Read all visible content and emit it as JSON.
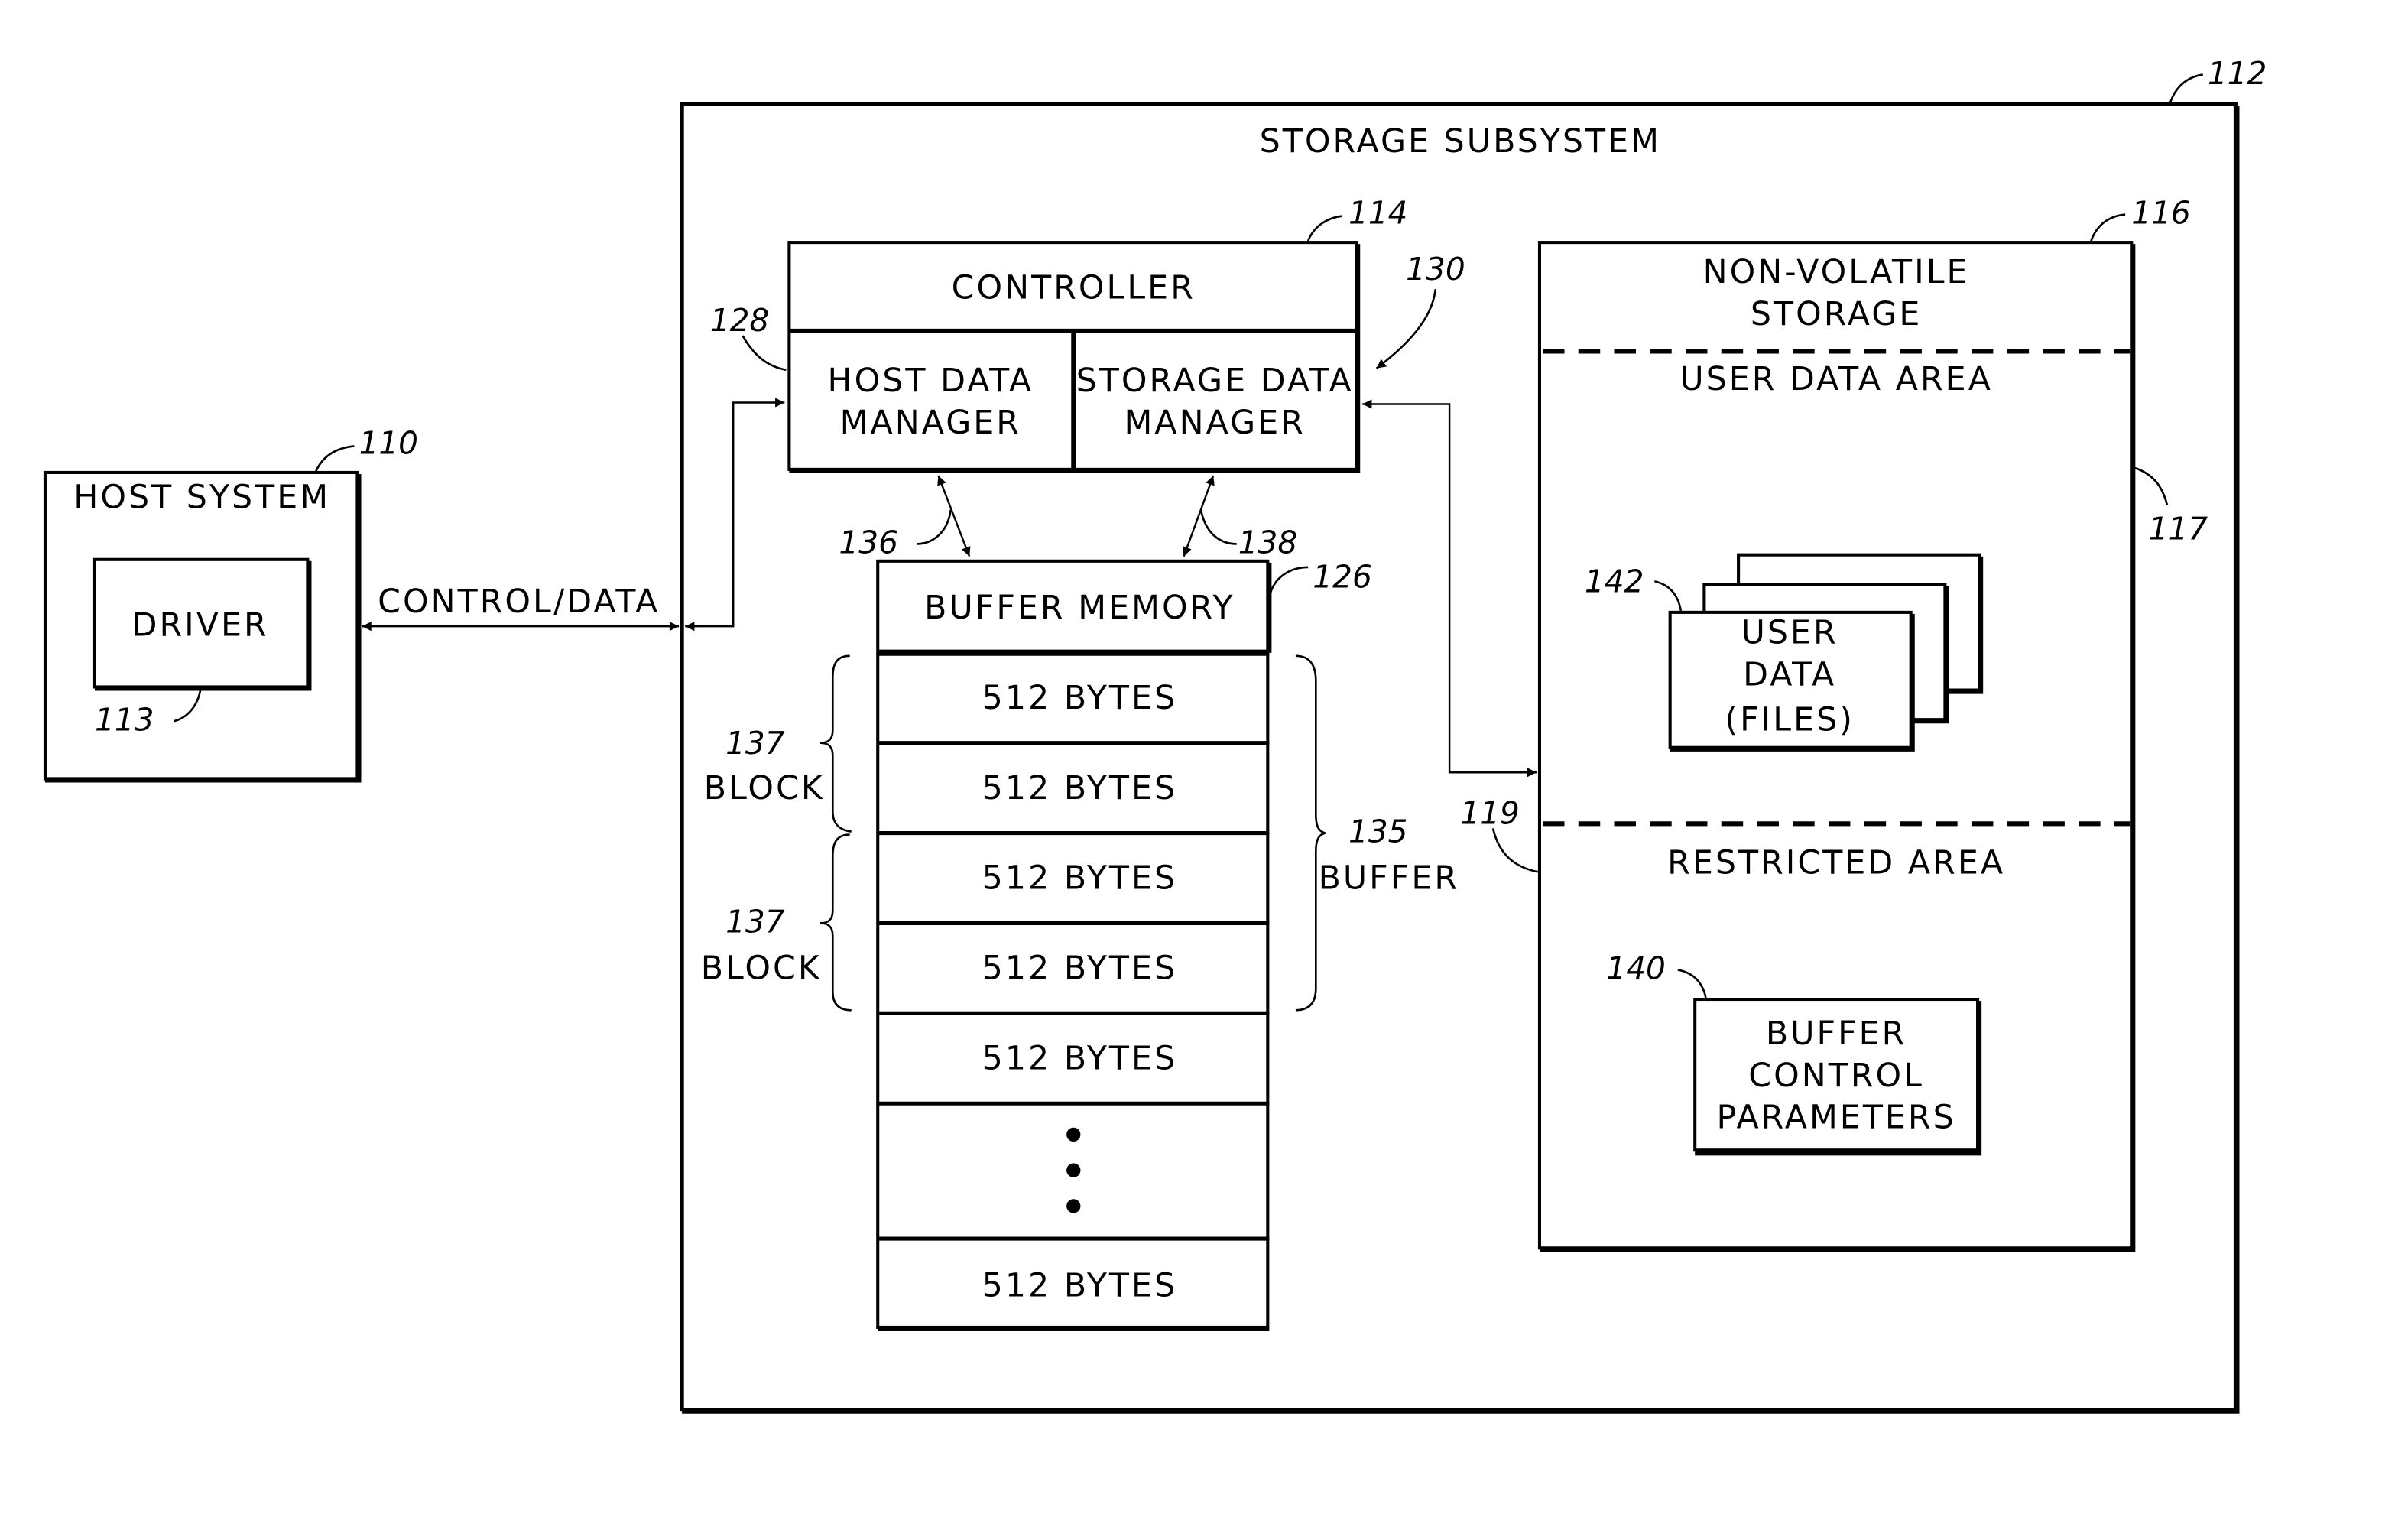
{
  "host_system": {
    "title": "HOST SYSTEM",
    "ref": "110",
    "driver": {
      "label": "DRIVER",
      "ref": "113"
    }
  },
  "link": {
    "label": "CONTROL/DATA"
  },
  "storage_subsystem": {
    "title": "STORAGE SUBSYSTEM",
    "ref": "112",
    "controller": {
      "label": "CONTROLLER",
      "ref": "114",
      "host_data_manager": {
        "line1": "HOST DATA",
        "line2": "MANAGER",
        "ref": "128"
      },
      "storage_data_manager": {
        "line1": "STORAGE DATA",
        "line2": "MANAGER",
        "ref": "130"
      }
    },
    "arrows": {
      "host_to_buffer_ref": "136",
      "storage_to_buffer_ref": "138",
      "nvs_link_ref": "119"
    },
    "buffer_memory": {
      "label": "BUFFER MEMORY",
      "ref": "126",
      "rows": [
        "512 BYTES",
        "512 BYTES",
        "512 BYTES",
        "512 BYTES",
        "512 BYTES",
        "...",
        "512 BYTES"
      ],
      "blocks": [
        {
          "ref": "137",
          "label": "BLOCK"
        },
        {
          "ref": "137",
          "label": "BLOCK"
        }
      ],
      "buffer": {
        "ref": "135",
        "label": "BUFFER"
      }
    },
    "non_volatile_storage": {
      "line1": "NON-VOLATILE",
      "line2": "STORAGE",
      "ref": "116",
      "user_data_area": {
        "label": "USER DATA AREA",
        "ref": "117",
        "files": {
          "line1": "USER",
          "line2": "DATA",
          "line3": "(FILES)",
          "ref": "142"
        }
      },
      "restricted_area": {
        "label": "RESTRICTED AREA",
        "params": {
          "line1": "BUFFER",
          "line2": "CONTROL",
          "line3": "PARAMETERS",
          "ref": "140"
        }
      }
    }
  }
}
